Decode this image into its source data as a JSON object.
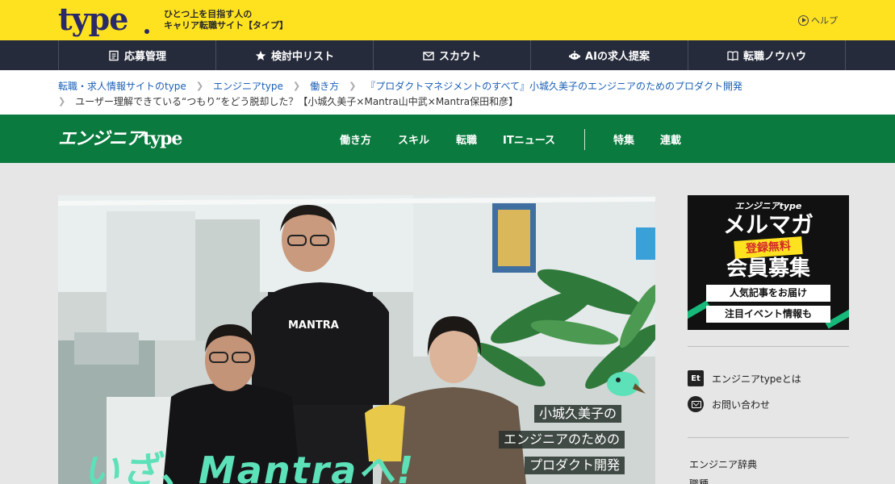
{
  "header": {
    "logo": "type",
    "tagline_line1": "ひとつ上を目指す人の",
    "tagline_line2": "キャリア転職サイト【タイプ】",
    "help": "ヘルプ",
    "brand_color": "#ffe21f"
  },
  "nav": {
    "items": [
      {
        "label": "応募管理",
        "icon": "document-icon"
      },
      {
        "label": "検討中リスト",
        "icon": "star-icon"
      },
      {
        "label": "スカウト",
        "icon": "mail-icon"
      },
      {
        "label": "AIの求人提案",
        "icon": "robot-icon"
      },
      {
        "label": "転職ノウハウ",
        "icon": "book-icon"
      }
    ]
  },
  "breadcrumb": {
    "items": [
      "転職・求人情報サイトのtype",
      "エンジニアtype",
      "働き方",
      "『プロダクトマネジメントのすべて』小城久美子のエンジニアのためのプロダクト開発"
    ],
    "current": "ユーザー理解できている“つもり”をどう脱却した？【小城久美子×Mantra山中武×Mantra保田和彦】"
  },
  "site": {
    "logo": "エンジニアtype",
    "logo_main": "エンジニア",
    "logo_type": "type",
    "menu": [
      "働き方",
      "スキル",
      "転職",
      "ITニュース"
    ],
    "menu2": [
      "特集",
      "連載"
    ],
    "green": "#0a7a3e"
  },
  "hero": {
    "title_lines": [
      "小城久美子の",
      "エンジニアのための",
      "プロダクト開発"
    ],
    "big_text": "いざ、Mantraへ!",
    "shirt_text": "MANTRA"
  },
  "sidebar": {
    "banner": {
      "brand": "エンジニアtype",
      "title": "メルマガ",
      "badge": "登録無料",
      "subtitle": "会員募集",
      "pill1": "人気記事をお届け",
      "pill2": "注目イベント情報も"
    },
    "links": [
      {
        "label": "エンジニアtypeとは",
        "icon": "et-icon",
        "icon_text": "Et"
      },
      {
        "label": "お問い合わせ",
        "icon": "mail-icon"
      }
    ],
    "text_links": [
      "エンジニア辞典",
      "職種"
    ]
  }
}
